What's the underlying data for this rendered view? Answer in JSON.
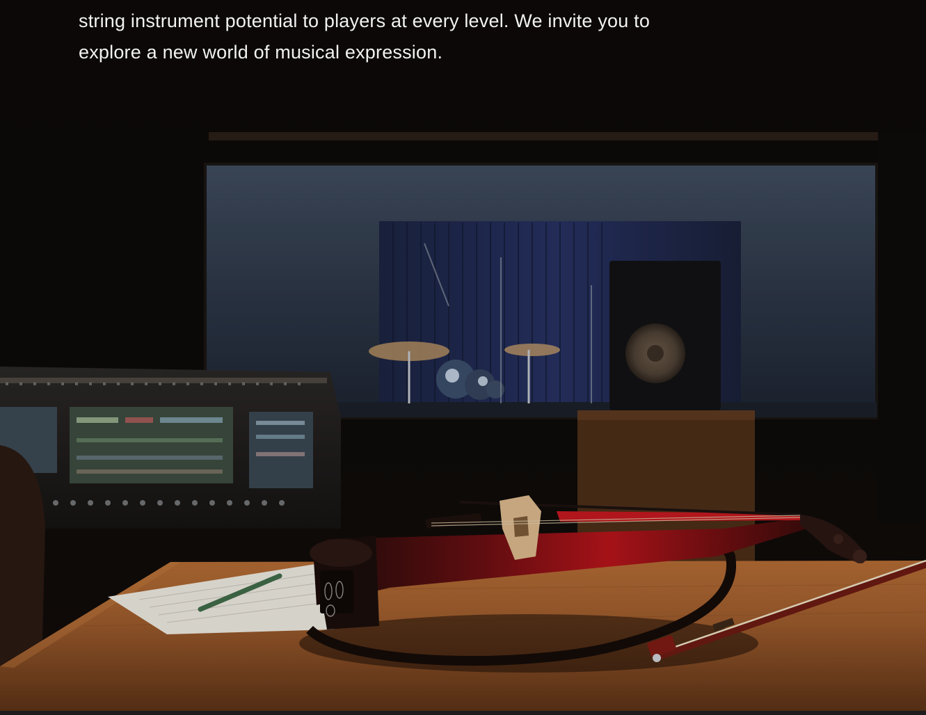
{
  "intro": {
    "line1": "string instrument potential to players at every level. We invite you to",
    "line2": "explore a new world of musical expression."
  },
  "colors": {
    "background": "#0c0908",
    "text": "#f2f2f2",
    "violin_accent": "#b3141a",
    "desk_wood": "#9a5a2c"
  },
  "image": {
    "alt": "Electric violin resting on a wooden desk in a recording studio with a mixing console and drum kit in the background"
  }
}
